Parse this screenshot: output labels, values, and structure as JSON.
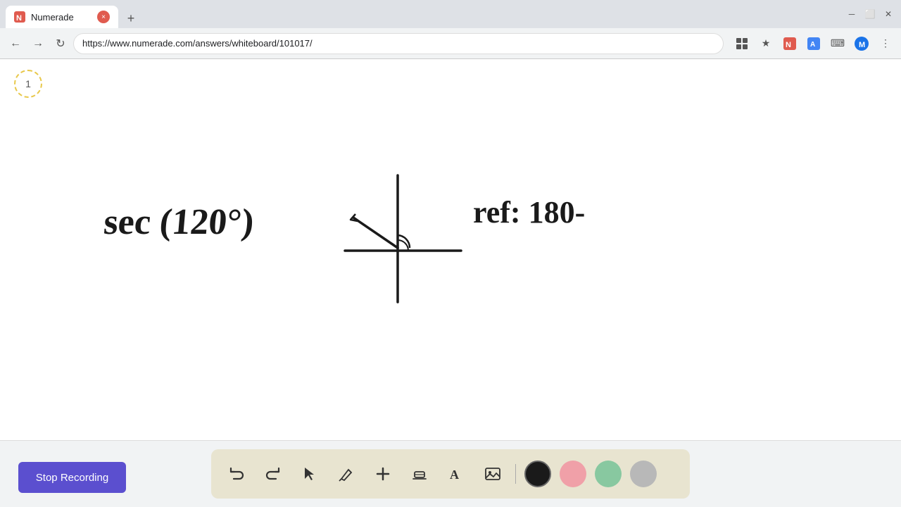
{
  "browser": {
    "tab_title": "Numerade",
    "url": "https://www.numerade.com/answers/whiteboard/101017/",
    "new_tab_label": "+"
  },
  "page": {
    "page_number": "1"
  },
  "toolbar": {
    "stop_recording_label": "Stop Recording",
    "tools": [
      {
        "name": "undo",
        "icon": "↺"
      },
      {
        "name": "redo",
        "icon": "↻"
      },
      {
        "name": "select",
        "icon": "▲"
      },
      {
        "name": "pen",
        "icon": "✎"
      },
      {
        "name": "add",
        "icon": "+"
      },
      {
        "name": "eraser",
        "icon": "◻"
      },
      {
        "name": "text",
        "icon": "A"
      }
    ],
    "colors": [
      {
        "name": "black",
        "hex": "#1a1a1a"
      },
      {
        "name": "pink",
        "hex": "#f0a0a8"
      },
      {
        "name": "green",
        "hex": "#88c8a0"
      },
      {
        "name": "gray",
        "hex": "#b8b8b8"
      }
    ]
  }
}
